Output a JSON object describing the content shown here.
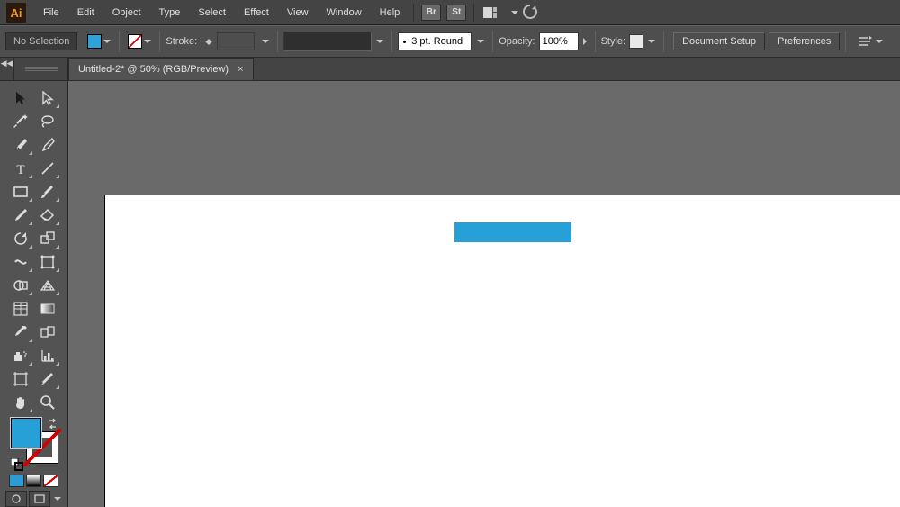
{
  "app_name": "Ai",
  "menu": [
    "File",
    "Edit",
    "Object",
    "Type",
    "Select",
    "Effect",
    "View",
    "Window",
    "Help"
  ],
  "menubar_buttons": {
    "bridge": "Br",
    "stock": "St"
  },
  "options": {
    "selection": "No Selection",
    "stroke_label": "Stroke:",
    "brush": "3 pt. Round",
    "opacity_label": "Opacity:",
    "opacity_value": "100%",
    "style_label": "Style:",
    "doc_setup": "Document Setup",
    "prefs": "Preferences"
  },
  "tab": {
    "title": "Untitled-2* @ 50% (RGB/Preview)",
    "close": "×"
  },
  "dock_toggle": "◀◀",
  "colors": {
    "fill": "#27a0d8",
    "artboard": "#ffffff",
    "pasteboard": "#6a6a6a"
  },
  "shape": {
    "kind": "rectangle"
  }
}
